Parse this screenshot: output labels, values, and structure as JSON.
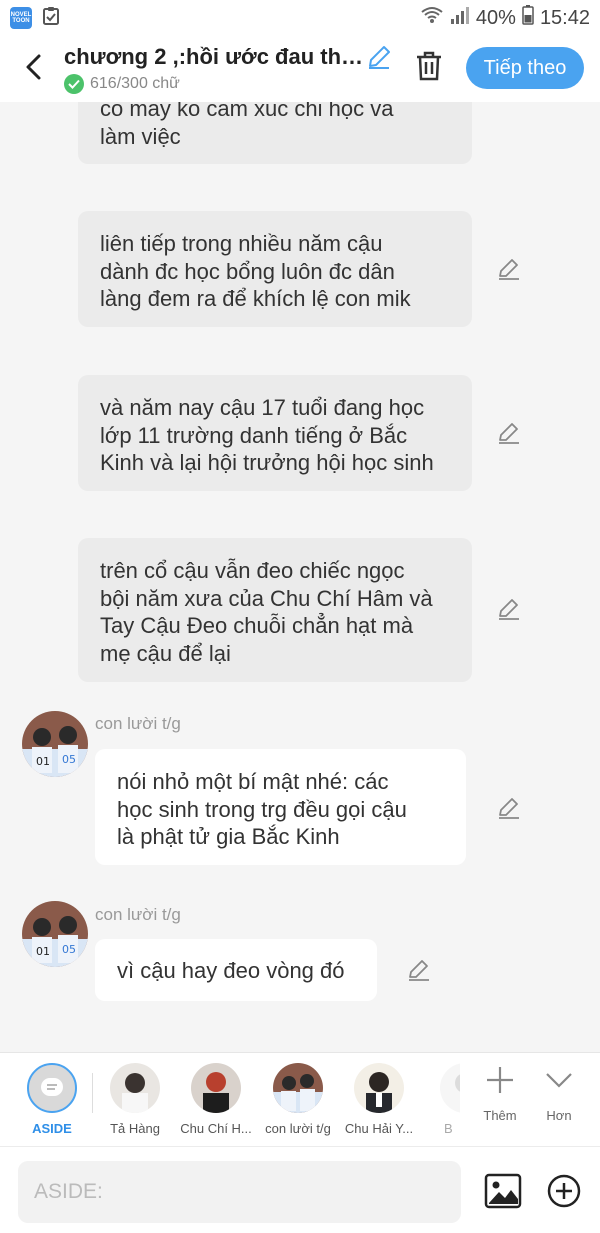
{
  "status_bar": {
    "app_logo_text": "NOVEL TOON",
    "battery_percent": "40%",
    "time": "15:42"
  },
  "header": {
    "title": "chương 2 ,:hồi ước đau thư...",
    "word_count": "616/300 chữ",
    "next_label": "Tiếp theo"
  },
  "messages": [
    {
      "text": "co may ko cam xuc chi học va\nlàm việc"
    },
    {
      "text": "liên tiếp trong nhiều năm cậu\ndành đc học bổng luôn đc dân\nlàng đem ra để khích lệ con mik"
    },
    {
      "text": "và năm nay cậu 17 tuổi đang học\nlớp 11 trường danh tiếng ở Bắc\nKinh và lại hội trưởng hội học sinh"
    },
    {
      "text": "trên cổ cậu vẫn đeo chiếc ngọc\nbội năm xưa của Chu Chí Hâm và\nTay Cậu Đeo chuỗi chẳn hạt mà\nmẹ cậu để lại"
    },
    {
      "speaker": "con lười t/g",
      "text": "nói nhỏ một bí mật nhé: các\nhọc sinh trong trg đều gọi cậu\nlà phật tử gia Bắc Kinh"
    },
    {
      "speaker": "con lười t/g",
      "text": "vì cậu hay đeo vòng đó"
    }
  ],
  "characters": [
    {
      "label": "ASIDE"
    },
    {
      "label": "Tả Hàng"
    },
    {
      "label": "Chu Chí H..."
    },
    {
      "label": "con lười t/g"
    },
    {
      "label": "Chu Hải Y..."
    },
    {
      "label": "B"
    }
  ],
  "bar_actions": {
    "add_label": "Thêm",
    "more_label": "Hơn"
  },
  "input": {
    "placeholder": "ASIDE:"
  },
  "colors": {
    "accent": "#4aa3f0",
    "bubble_gray": "#ebebeb",
    "background": "#f5f5f5",
    "check_green": "#4cc26a"
  }
}
